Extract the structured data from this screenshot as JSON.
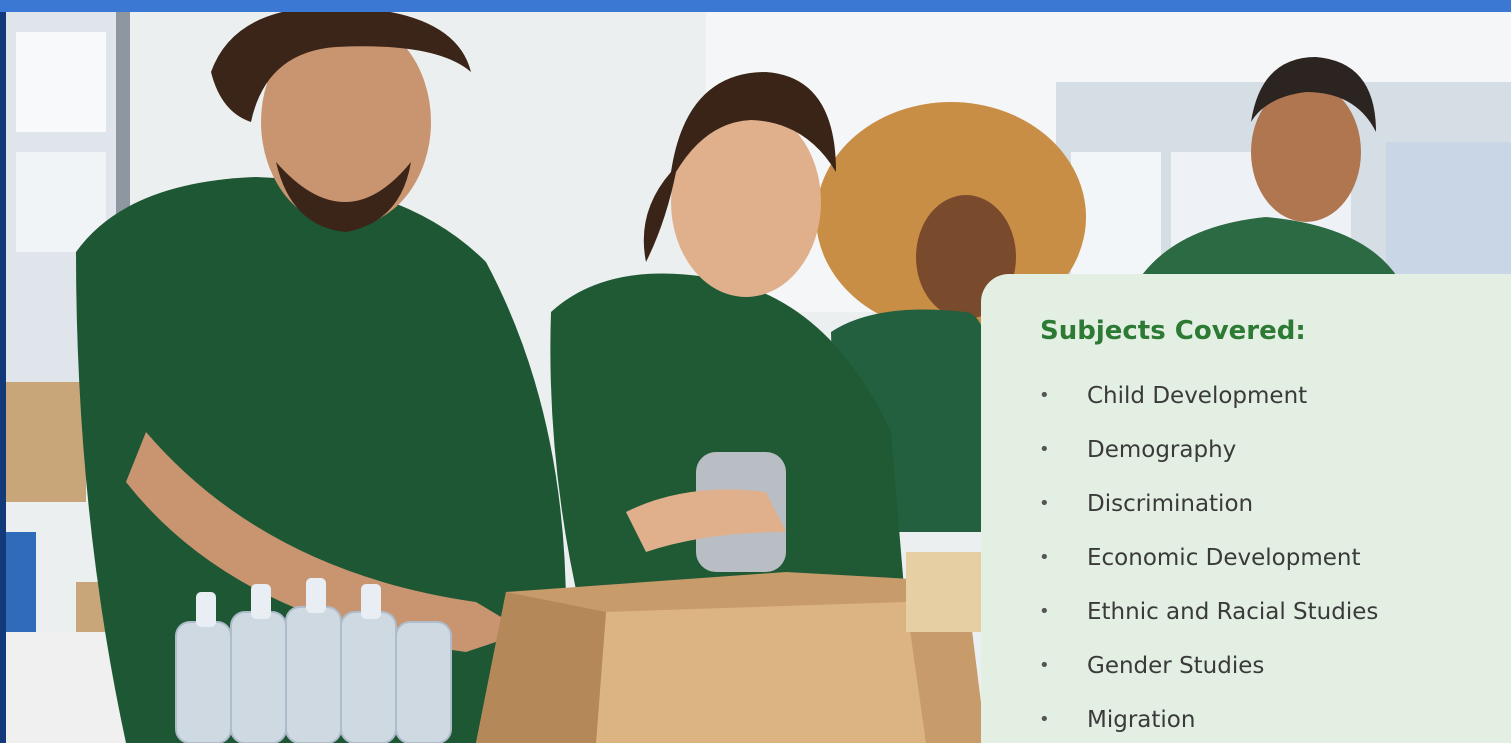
{
  "header": {
    "accent_color": "#3b78d4"
  },
  "hero_image": {
    "description_icon": "volunteers-photo",
    "shirt_color": "#1f5a35"
  },
  "subjects": {
    "title": "Subjects Covered:",
    "title_color": "#2d7a34",
    "panel_color": "#e3efe3",
    "bullet": "•",
    "items": [
      {
        "label": "Child Development"
      },
      {
        "label": "Demography"
      },
      {
        "label": "Discrimination"
      },
      {
        "label": "Economic Development"
      },
      {
        "label": "Ethnic and Racial Studies"
      },
      {
        "label": "Gender Studies"
      },
      {
        "label": "Migration"
      }
    ]
  }
}
